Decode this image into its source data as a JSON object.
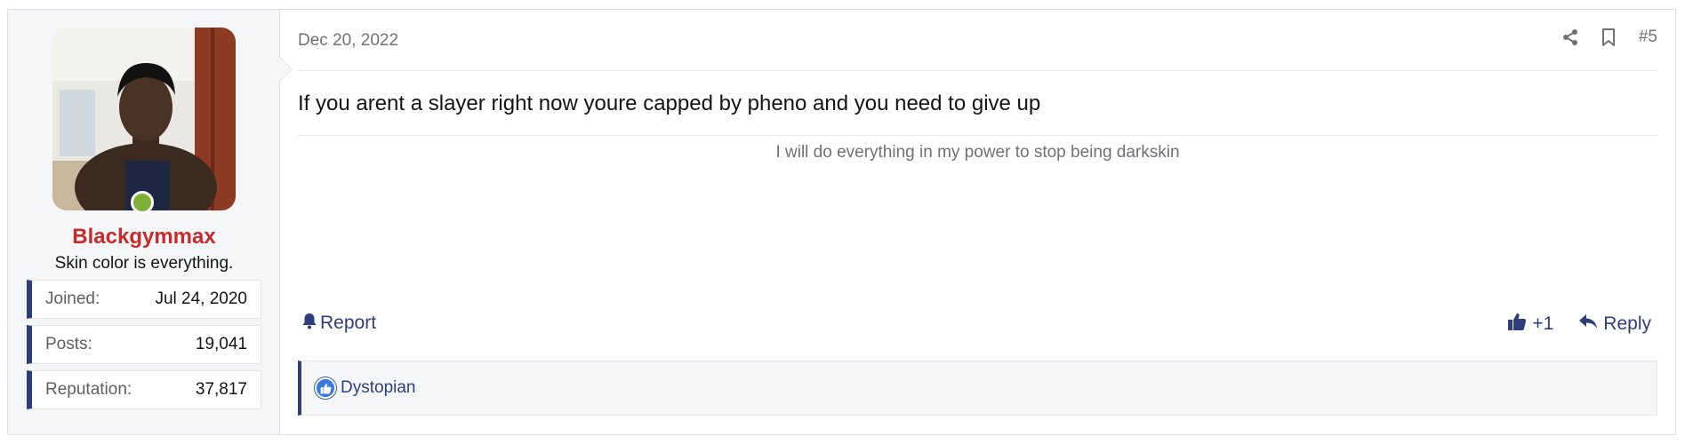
{
  "user": {
    "name": "Blackgymmax",
    "title": "Skin color is everything.",
    "stats": [
      {
        "label": "Joined:",
        "value": "Jul 24, 2020"
      },
      {
        "label": "Posts:",
        "value": "19,041"
      },
      {
        "label": "Reputation:",
        "value": "37,817"
      }
    ]
  },
  "post": {
    "date": "Dec 20, 2022",
    "number": "#5",
    "message": "If you arent a slayer right now youre capped by pheno and you need to give up",
    "signature": "I will do everything in my power to stop being darkskin",
    "report_label": "Report",
    "like_label": "+1",
    "reply_label": "Reply",
    "reactions_user": "Dystopian"
  },
  "icons": {
    "share": "share-icon",
    "bookmark": "bookmark-icon",
    "report": "bell-icon",
    "like": "thumbs-up-icon",
    "reply": "reply-icon"
  },
  "colors": {
    "username": "#c62c2c",
    "accent": "#2d3e7a",
    "online": "#7fb13a"
  }
}
